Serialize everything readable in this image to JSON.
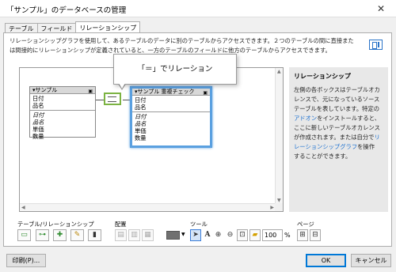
{
  "window": {
    "title": "「サンプル」のデータベースの管理",
    "close_glyph": "✕"
  },
  "tabs": [
    {
      "label": "テーブル"
    },
    {
      "label": "フィールド"
    },
    {
      "label": "リレーションシップ"
    }
  ],
  "description": "リレーションシップグラフを使用して、あるテーブルのデータに別のテーブルからアクセスできます。２つのテーブルの間に直接または間接的にリレーションシップが定義されていると、一方のテーブルのフィールドに他方のテーブルからアクセスできます。",
  "graph": {
    "left_tocc": {
      "name": "サンプル",
      "key_fields": [
        "日付",
        "品名"
      ],
      "fields": [
        "日付",
        "品名",
        "単価",
        "数量"
      ]
    },
    "right_tocc": {
      "name": "サンプル 重複チェック",
      "key_fields": [
        "日付",
        "品名"
      ],
      "fields": [
        "日付",
        "品名",
        "単価",
        "数量"
      ]
    }
  },
  "callout": {
    "text": "「＝」でリレーション"
  },
  "help": {
    "title": "リレーションシップ",
    "text_parts": [
      "左側の各ボックスはテーブルオカレンスで、元になっているソーステーブルを表しています。特定の",
      "アドオン",
      "をインストールすると、ここに新しいテーブルオカレンスが作成されます。または自分で",
      "リレーションシップグラフ",
      "を操作することができます。"
    ],
    "link_color": "#1a6fd0"
  },
  "toolbar": {
    "group1_label": "テーブル/リレーションシップ",
    "group2_label": "配置",
    "group3_label": "ツール",
    "group4_label": "ページ",
    "zoom_value": "100",
    "zoom_unit": "%",
    "icons": {
      "add_table": "add-table-icon",
      "add_relationship": "add-relationship-icon",
      "duplicate": "duplicate-icon",
      "edit": "edit-pencil-icon",
      "delete": "delete-icon",
      "select": "pointer-icon",
      "text": "text-tool-icon",
      "zoom_in": "zoom-in-icon",
      "zoom_out": "zoom-out-icon",
      "fit": "fit-window-icon",
      "note": "note-icon",
      "page_setup": "page-setup-icon",
      "page_breaks": "page-breaks-icon"
    }
  },
  "footer": {
    "print_label": "印刷(P)...",
    "ok_label": "OK",
    "cancel_label": "キャンセル"
  },
  "colors": {
    "accent": "#2a74c8",
    "selected_tocc_border": "#5aa0e0",
    "relation_box_border": "#7cb342",
    "help_bg": "#e8e8e8"
  }
}
